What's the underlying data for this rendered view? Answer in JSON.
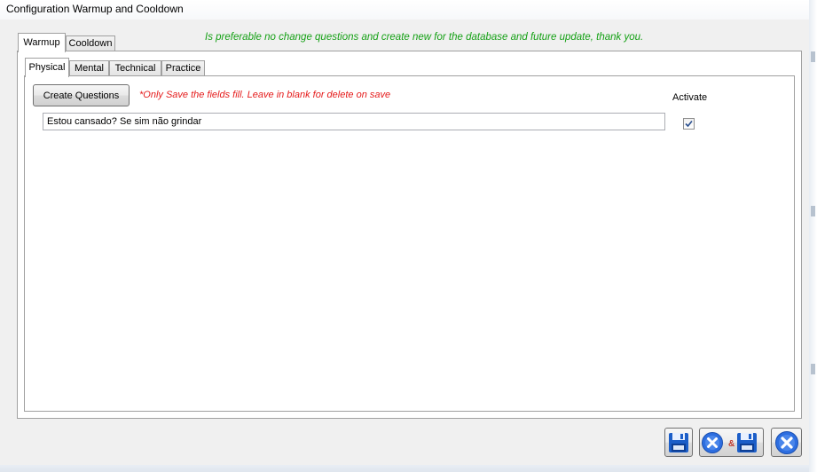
{
  "window": {
    "title": "Configuration Warmup and Cooldown"
  },
  "outer_tabs": [
    {
      "label": "Warmup",
      "active": true
    },
    {
      "label": "Cooldown",
      "active": false
    }
  ],
  "info_message": "Is preferable no change questions and create new for the database and future update, thank you.",
  "inner_tabs": [
    {
      "label": "Physical",
      "active": true
    },
    {
      "label": "Mental",
      "active": false
    },
    {
      "label": "Technical",
      "active": false
    },
    {
      "label": "Practice",
      "active": false
    }
  ],
  "create_button_label": "Create Questions",
  "warning_message": "*Only Save the fields fill. Leave in blank for delete on save",
  "activate_label": "Activate",
  "questions": [
    {
      "text": "Estou cansado? Se sim não grindar",
      "activated": true
    }
  ],
  "footer_buttons": [
    {
      "icon": "save-icon"
    },
    {
      "icon": "close-and-save-icon"
    },
    {
      "icon": "close-icon"
    }
  ],
  "colors": {
    "info_green": "#14a014",
    "warning_red": "#e51c1c",
    "icon_blue": "#1c5ec8"
  }
}
